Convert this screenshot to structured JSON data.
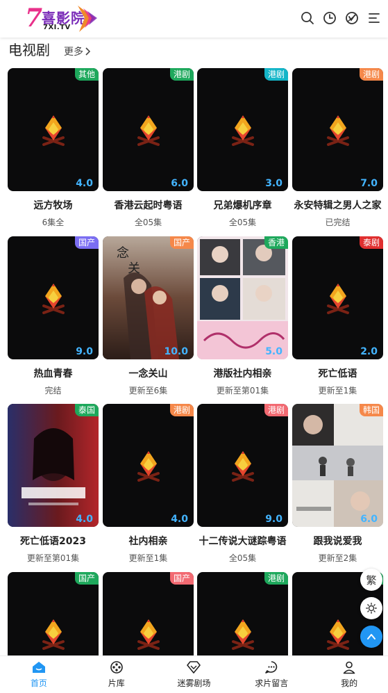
{
  "header": {
    "logo_mark": "7",
    "logo_name": "喜影院",
    "logo_sub": "7XI.TV",
    "icons": [
      "search-icon",
      "history-icon",
      "vip-icon",
      "menu-icon"
    ]
  },
  "section": {
    "title": "电视剧",
    "more_label": "更多"
  },
  "colors": {
    "accent": "#2196f3",
    "score": "#43b4ff",
    "badge_green": "#1ea85c",
    "badge_teal": "#14b5c8",
    "badge_orange": "#f5884a",
    "badge_purple": "#7b6ef2",
    "badge_red": "#e02f2f",
    "badge_pink": "#f26a72"
  },
  "cards": [
    {
      "title": "远方牧场",
      "status": "6集全",
      "badge": "其他",
      "badge_color": "#1ea85c",
      "score": "4.0",
      "poster": "placeholder"
    },
    {
      "title": "香港云起时粤语",
      "status": "全05集",
      "badge": "港剧",
      "badge_color": "#1ea85c",
      "score": "6.0",
      "poster": "placeholder"
    },
    {
      "title": "兄弟爆机序章",
      "status": "全05集",
      "badge": "港剧",
      "badge_color": "#14b5c8",
      "score": "3.0",
      "poster": "placeholder"
    },
    {
      "title": "永安特辑之男人之家",
      "status": "已完结",
      "badge": "港剧",
      "badge_color": "#f5884a",
      "score": "7.0",
      "poster": "placeholder"
    },
    {
      "title": "热血青春",
      "status": "完结",
      "badge": "国产",
      "badge_color": "#7b6ef2",
      "score": "9.0",
      "poster": "placeholder"
    },
    {
      "title": "一念关山",
      "status": "更新至6集",
      "badge": "国产",
      "badge_color": "#f5884a",
      "score": "10.0",
      "poster": "romance-poster"
    },
    {
      "title": "港版社内相亲",
      "status": "更新至第01集",
      "badge": "香港",
      "badge_color": "#1ea85c",
      "score": "5.0",
      "poster": "collage-poster"
    },
    {
      "title": "死亡低语",
      "status": "更新至1集",
      "badge": "泰剧",
      "badge_color": "#e02f2f",
      "score": "2.0",
      "poster": "placeholder"
    },
    {
      "title": "死亡低语2023",
      "status": "更新至第01集",
      "badge": "泰国",
      "badge_color": "#1ea85c",
      "score": "4.0",
      "poster": "horror-poster"
    },
    {
      "title": "社内相亲",
      "status": "更新至1集",
      "badge": "港剧",
      "badge_color": "#f5884a",
      "score": "4.0",
      "poster": "placeholder"
    },
    {
      "title": "十二传说大谜踪粤语",
      "status": "全05集",
      "badge": "港剧",
      "badge_color": "#f26a72",
      "score": "9.0",
      "poster": "placeholder"
    },
    {
      "title": "跟我说爱我",
      "status": "更新至2集",
      "badge": "韩国",
      "badge_color": "#f5884a",
      "score": "6.0",
      "poster": "drama-poster"
    },
    {
      "title": "",
      "status": "",
      "badge": "国产",
      "badge_color": "#1ea85c",
      "score": "",
      "poster": "placeholder"
    },
    {
      "title": "",
      "status": "",
      "badge": "国产",
      "badge_color": "#f26a72",
      "score": "",
      "poster": "placeholder"
    },
    {
      "title": "",
      "status": "",
      "badge": "港剧",
      "badge_color": "#1ea85c",
      "score": "",
      "poster": "placeholder"
    },
    {
      "title": "",
      "status": "",
      "badge": "",
      "badge_color": "#1ea85c",
      "score": "",
      "poster": "placeholder"
    }
  ],
  "floating": {
    "traditional_label": "繁",
    "theme_icon": "brightness-icon",
    "top_icon": "chevron-up-icon"
  },
  "tabbar": [
    {
      "label": "首页",
      "icon": "home-icon",
      "active": true
    },
    {
      "label": "片库",
      "icon": "film-reel-icon",
      "active": false
    },
    {
      "label": "迷雾剧场",
      "icon": "diamond-icon",
      "active": false
    },
    {
      "label": "求片留言",
      "icon": "chat-icon",
      "active": false
    },
    {
      "label": "我的",
      "icon": "user-icon",
      "active": false
    }
  ]
}
